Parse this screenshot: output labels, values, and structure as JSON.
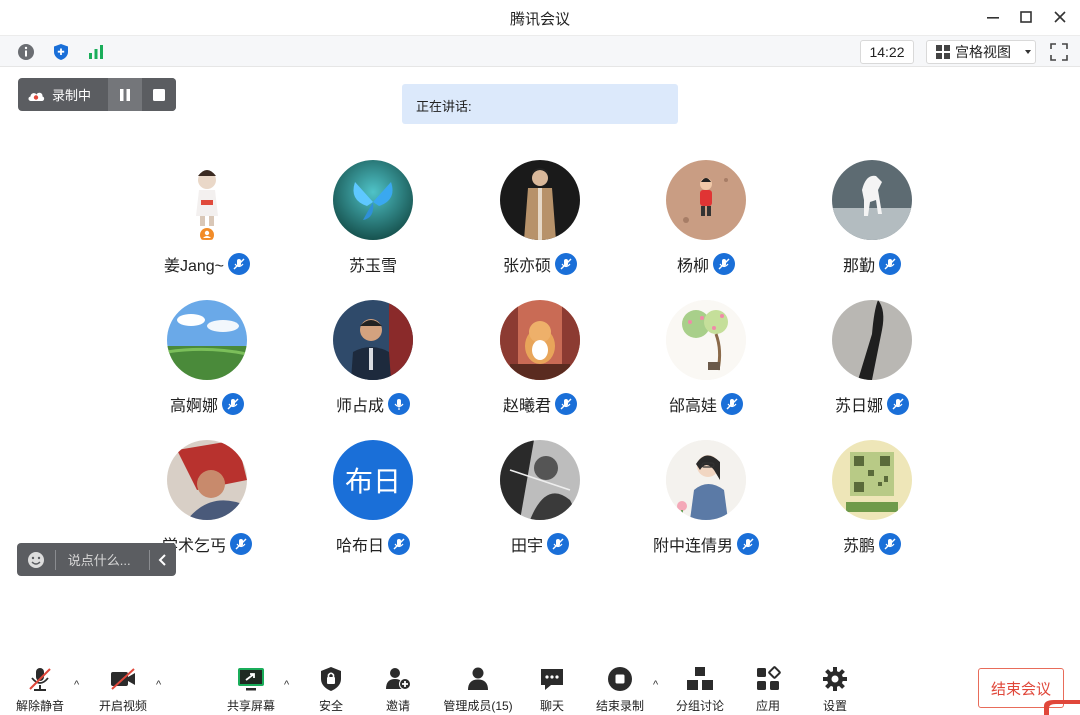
{
  "window": {
    "title": "腾讯会议"
  },
  "infobar": {
    "clock": "14:22",
    "view_label": "宫格视图"
  },
  "recording": {
    "label": "录制中"
  },
  "speaking": {
    "label": "正在讲话:"
  },
  "participants": [
    {
      "name": "姜Jang~",
      "mic_status": "muted-icon"
    },
    {
      "name": "苏玉雪",
      "mic_status": "none"
    },
    {
      "name": "张亦硕",
      "mic_status": "muted-icon"
    },
    {
      "name": "杨柳",
      "mic_status": "muted-icon"
    },
    {
      "name": "那勤",
      "mic_status": "muted-icon"
    },
    {
      "name": "高婀娜",
      "mic_status": "muted-icon"
    },
    {
      "name": "师占成",
      "mic_status": "mic-icon"
    },
    {
      "name": "赵曦君",
      "mic_status": "muted-icon"
    },
    {
      "name": "邰高娃",
      "mic_status": "muted-icon"
    },
    {
      "name": "苏日娜",
      "mic_status": "muted-icon"
    },
    {
      "name": "学术乞丐",
      "mic_status": "muted-icon"
    },
    {
      "name": "哈布日",
      "mic_status": "muted-icon",
      "initials": "布日"
    },
    {
      "name": "田宇",
      "mic_status": "muted-icon"
    },
    {
      "name": "附中连倩男",
      "mic_status": "muted-icon"
    },
    {
      "name": "苏鹏",
      "mic_status": "muted-icon"
    }
  ],
  "chat": {
    "placeholder": "说点什么..."
  },
  "toolbar": {
    "unmute": "解除静音",
    "video": "开启视频",
    "share": "共享屏幕",
    "security": "安全",
    "invite": "邀请",
    "members": "管理成员(15)",
    "chat": "聊天",
    "end_record": "结束录制",
    "breakout": "分组讨论",
    "apps": "应用",
    "settings": "设置",
    "end_meeting": "结束会议"
  },
  "colors": {
    "accent": "#1a6fd8",
    "danger": "#e0473a",
    "green": "#1aad5a"
  }
}
